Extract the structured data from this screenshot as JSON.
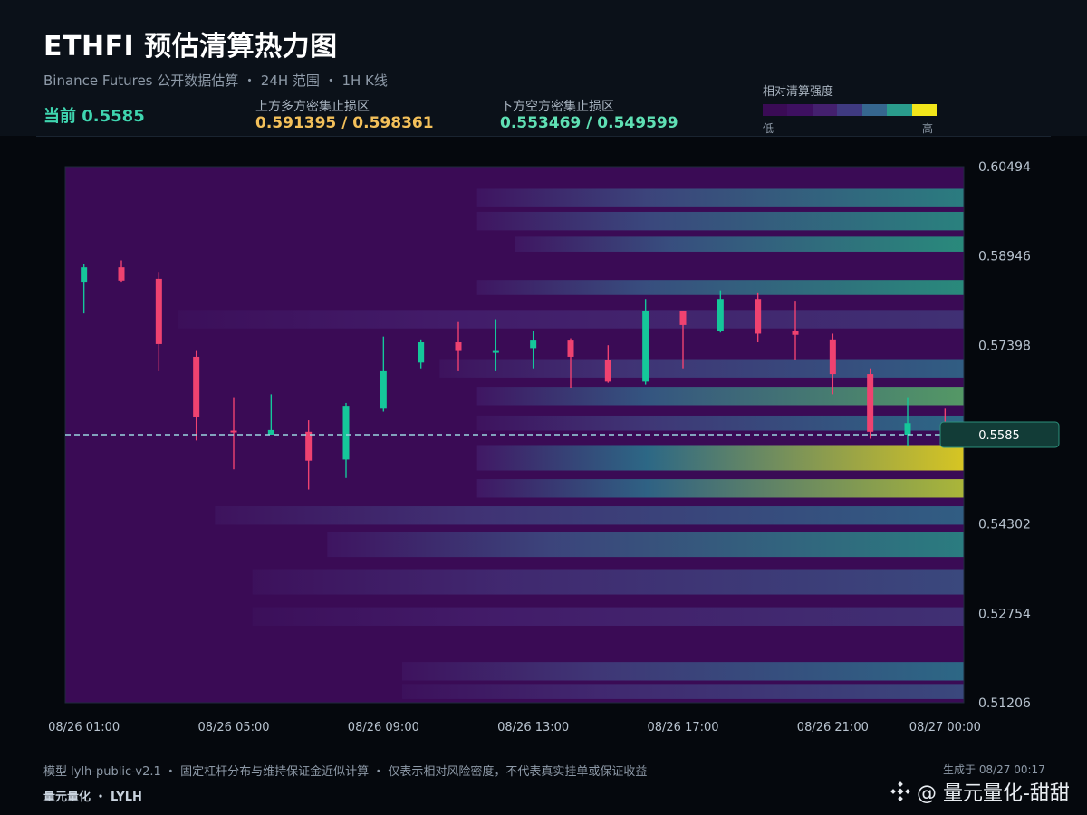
{
  "header": {
    "title": "ETHFI 预估清算热力图",
    "subtitle": "Binance Futures 公开数据估算 ・ 24H 范围 ・ 1H K线",
    "current_label": "当前 0.5585",
    "upper_zone_label": "上方多方密集止损区",
    "upper_zone_value": "0.591395 / 0.598361",
    "lower_zone_label": "下方空方密集止损区",
    "lower_zone_value": "0.553469 / 0.549599"
  },
  "legend": {
    "title": "相对清算强度",
    "low": "低",
    "high": "高",
    "colors": [
      "#3a0b55",
      "#3e1060",
      "#44206e",
      "#3f3a80",
      "#36678f",
      "#2a9c8c",
      "#f2e61a"
    ]
  },
  "footer": {
    "note": "模型 lylh-public-v2.1 ・ 固定杠杆分布与维持保证金近似计算 ・ 仅表示相对风险密度，不代表真实挂单或保证收益",
    "brand": "量元量化 ・ LYLH",
    "generated": "生成于 08/27 00:17",
    "watermark": "@ 量元量化-甜甜"
  },
  "chart_data": {
    "type": "heatmap",
    "overlay": "candlestick",
    "ylim": [
      0.51206,
      0.60494
    ],
    "y_ticks": [
      "0.60494",
      "0.58946",
      "0.57398",
      "0.54302",
      "0.52754",
      "0.51206"
    ],
    "x_tick_labels": [
      "08/26 01:00",
      "08/26 05:00",
      "08/26 09:00",
      "08/26 13:00",
      "08/26 17:00",
      "08/26 21:00",
      "08/27 00:00"
    ],
    "current_price": 0.5585,
    "current_price_label": "0.5585",
    "colors": {
      "up": "#15c79a",
      "down": "#ef4270",
      "current_line": "#9ad6e0"
    },
    "candles": [
      {
        "time": "08/26 01:00",
        "open": 0.585,
        "high": 0.588,
        "low": 0.5795,
        "close": 0.5875
      },
      {
        "time": "08/26 02:00",
        "open": 0.5875,
        "high": 0.5887,
        "low": 0.585,
        "close": 0.5852
      },
      {
        "time": "08/26 03:00",
        "open": 0.5855,
        "high": 0.5867,
        "low": 0.5695,
        "close": 0.5742
      },
      {
        "time": "08/26 04:00",
        "open": 0.572,
        "high": 0.573,
        "low": 0.5575,
        "close": 0.5615
      },
      {
        "time": "08/26 05:00",
        "open": 0.5592,
        "high": 0.565,
        "low": 0.5525,
        "close": 0.559
      },
      {
        "time": "08/26 06:00",
        "open": 0.5585,
        "high": 0.5655,
        "low": 0.5585,
        "close": 0.5593
      },
      {
        "time": "08/26 07:00",
        "open": 0.559,
        "high": 0.561,
        "low": 0.549,
        "close": 0.554
      },
      {
        "time": "08/26 08:00",
        "open": 0.5542,
        "high": 0.564,
        "low": 0.551,
        "close": 0.5635
      },
      {
        "time": "08/26 09:00",
        "open": 0.563,
        "high": 0.5755,
        "low": 0.5625,
        "close": 0.5695
      },
      {
        "time": "08/26 10:00",
        "open": 0.571,
        "high": 0.575,
        "low": 0.57,
        "close": 0.5745
      },
      {
        "time": "08/26 11:00",
        "open": 0.5745,
        "high": 0.578,
        "low": 0.5695,
        "close": 0.573
      },
      {
        "time": "08/26 12:00",
        "open": 0.5728,
        "high": 0.5785,
        "low": 0.5695,
        "close": 0.573
      },
      {
        "time": "08/26 13:00",
        "open": 0.5735,
        "high": 0.5765,
        "low": 0.57,
        "close": 0.5748
      },
      {
        "time": "08/26 14:00",
        "open": 0.5748,
        "high": 0.5752,
        "low": 0.5665,
        "close": 0.572
      },
      {
        "time": "08/26 15:00",
        "open": 0.5715,
        "high": 0.574,
        "low": 0.5675,
        "close": 0.5677
      },
      {
        "time": "08/26 16:00",
        "open": 0.5677,
        "high": 0.582,
        "low": 0.5672,
        "close": 0.58
      },
      {
        "time": "08/26 17:00",
        "open": 0.58,
        "high": 0.58,
        "low": 0.57,
        "close": 0.5775
      },
      {
        "time": "08/26 18:00",
        "open": 0.5765,
        "high": 0.5835,
        "low": 0.5762,
        "close": 0.582
      },
      {
        "time": "08/26 19:00",
        "open": 0.582,
        "high": 0.583,
        "low": 0.5745,
        "close": 0.576
      },
      {
        "time": "08/26 20:00",
        "open": 0.5765,
        "high": 0.5817,
        "low": 0.5715,
        "close": 0.5758
      },
      {
        "time": "08/26 21:00",
        "open": 0.575,
        "high": 0.576,
        "low": 0.5655,
        "close": 0.569
      },
      {
        "time": "08/26 22:00",
        "open": 0.569,
        "high": 0.57,
        "low": 0.5578,
        "close": 0.559
      },
      {
        "time": "08/26 23:00",
        "open": 0.5585,
        "high": 0.565,
        "low": 0.5565,
        "close": 0.5605
      },
      {
        "time": "08/27 00:00",
        "open": 0.56,
        "high": 0.563,
        "low": 0.5585,
        "close": 0.5585
      }
    ],
    "bands": [
      {
        "center": 0.5995,
        "width": 0.0016,
        "start": "08/26 12:00",
        "peak": 0.72
      },
      {
        "center": 0.5955,
        "width": 0.0016,
        "start": "08/26 12:00",
        "peak": 0.75
      },
      {
        "center": 0.5915,
        "width": 0.0013,
        "start": "08/26 13:00",
        "peak": 0.8
      },
      {
        "center": 0.584,
        "width": 0.0013,
        "start": "08/26 12:00",
        "peak": 0.8
      },
      {
        "center": 0.5785,
        "width": 0.0016,
        "start": "08/26 04:00",
        "peak": 0.32
      },
      {
        "center": 0.57,
        "width": 0.0016,
        "start": "08/26 11:00",
        "peak": 0.55
      },
      {
        "center": 0.5652,
        "width": 0.0016,
        "start": "08/26 12:00",
        "peak": 0.85
      },
      {
        "center": 0.5605,
        "width": 0.0013,
        "start": "08/26 12:00",
        "peak": 0.6
      },
      {
        "center": 0.5545,
        "width": 0.0022,
        "start": "08/26 12:00",
        "peak": 1.0
      },
      {
        "center": 0.5492,
        "width": 0.0016,
        "start": "08/26 12:00",
        "peak": 0.95
      },
      {
        "center": 0.5445,
        "width": 0.0016,
        "start": "08/26 05:00",
        "peak": 0.55
      },
      {
        "center": 0.5395,
        "width": 0.0022,
        "start": "08/26 08:00",
        "peak": 0.72
      },
      {
        "center": 0.533,
        "width": 0.0022,
        "start": "08/26 06:00",
        "peak": 0.45
      },
      {
        "center": 0.527,
        "width": 0.0016,
        "start": "08/26 06:00",
        "peak": 0.32
      },
      {
        "center": 0.5175,
        "width": 0.0016,
        "start": "08/26 10:00",
        "peak": 0.6
      },
      {
        "center": 0.514,
        "width": 0.0013,
        "start": "08/26 10:00",
        "peak": 0.45
      }
    ]
  }
}
